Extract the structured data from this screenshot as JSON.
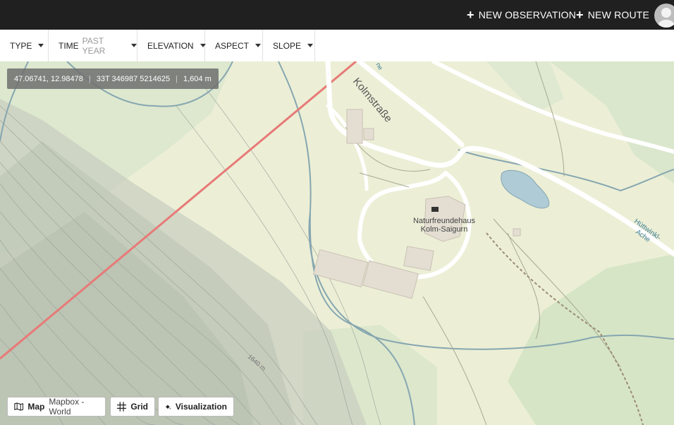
{
  "header": {
    "new_observation": "NEW OBSERVATION",
    "new_route": "NEW ROUTE"
  },
  "filters": [
    {
      "label": "TYPE",
      "sub": ""
    },
    {
      "label": "TIME",
      "sub": "PAST YEAR"
    },
    {
      "label": "ELEVATION",
      "sub": ""
    },
    {
      "label": "ASPECT",
      "sub": ""
    },
    {
      "label": "SLOPE",
      "sub": ""
    }
  ],
  "coords": {
    "latlon": "47.06741, 12.98478",
    "utm": "33T 346987 5214625",
    "elevation": "1,604 m"
  },
  "map_labels": {
    "road": "Kolmstraße",
    "hut_line1": "Naturfreundehaus",
    "hut_line2": "Kolm-Saigurn",
    "stream": "Hüttwinkl-Ache",
    "contour": "1640 m",
    "fragment": "ne"
  },
  "controls": {
    "map_label": "Map",
    "map_source": "Mapbox - World",
    "grid_label": "Grid",
    "viz_label": "Visualization"
  }
}
